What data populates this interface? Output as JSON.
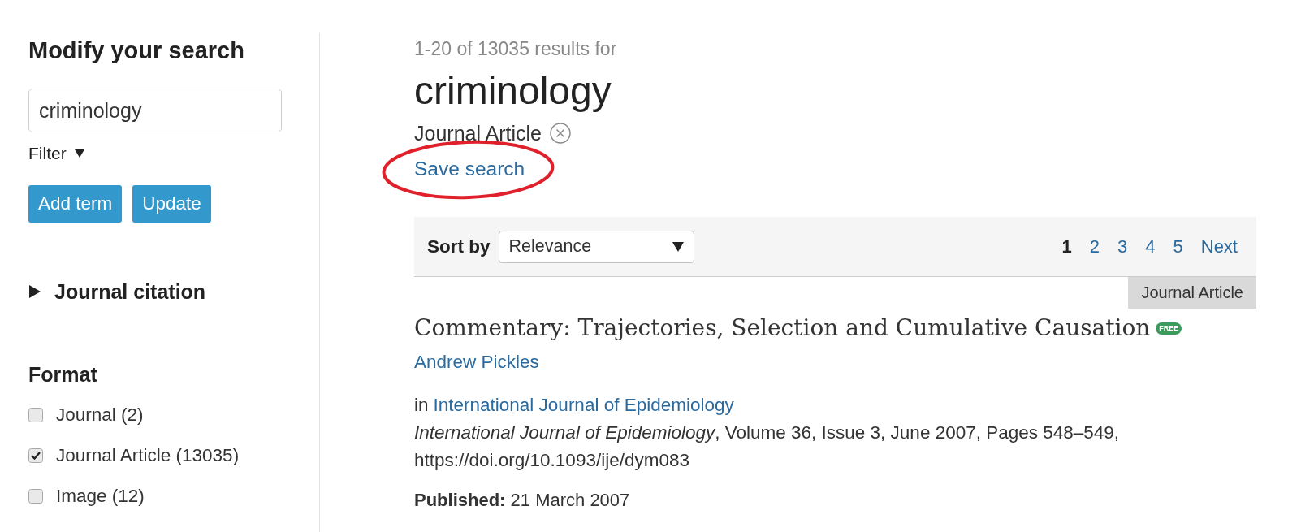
{
  "sidebar": {
    "title": "Modify your search",
    "search": {
      "value": "criminology"
    },
    "filter": {
      "label": "Filter"
    },
    "buttons": [
      "Add term",
      "Update"
    ],
    "sections": [
      {
        "title": "Journal citation",
        "expanded": false
      }
    ],
    "format": {
      "title": "Format",
      "options": [
        {
          "label": "Journal (2)",
          "checked": false
        },
        {
          "label": "Journal Article (13035)",
          "checked": true
        },
        {
          "label": "Image (12)",
          "checked": false
        }
      ]
    }
  },
  "results_header": {
    "summary": "1-20 of 13035 results for",
    "query": "criminology",
    "active_filters": [
      {
        "label": "Journal Article"
      }
    ],
    "save_search": {
      "label": "Save search",
      "circled": true
    }
  },
  "sort_bar": {
    "label": "Sort by",
    "select": {
      "value": "Relevance"
    },
    "pages": [
      {
        "label": "1",
        "selected": true
      },
      {
        "label": "2",
        "selected": false
      },
      {
        "label": "3",
        "selected": false
      },
      {
        "label": "4",
        "selected": false
      },
      {
        "label": "5",
        "selected": false
      }
    ],
    "next": "Next"
  },
  "results": [
    {
      "format": "Journal Article",
      "title": "Commentary: Trajectories, Selection and Cumulative Causation",
      "badge": "FREE",
      "authors": [
        "Andrew Pickles"
      ],
      "journal_prefix": "in",
      "journal": "International Journal of Epidemiology",
      "citation": "*International Journal of Epidemiology*, Volume 36, Issue 3, June 2007, Pages 548–549,",
      "doi": "https://doi.org/10.1093/ije/dym083",
      "published": "**Published:** 21 March 2007"
    }
  ]
}
